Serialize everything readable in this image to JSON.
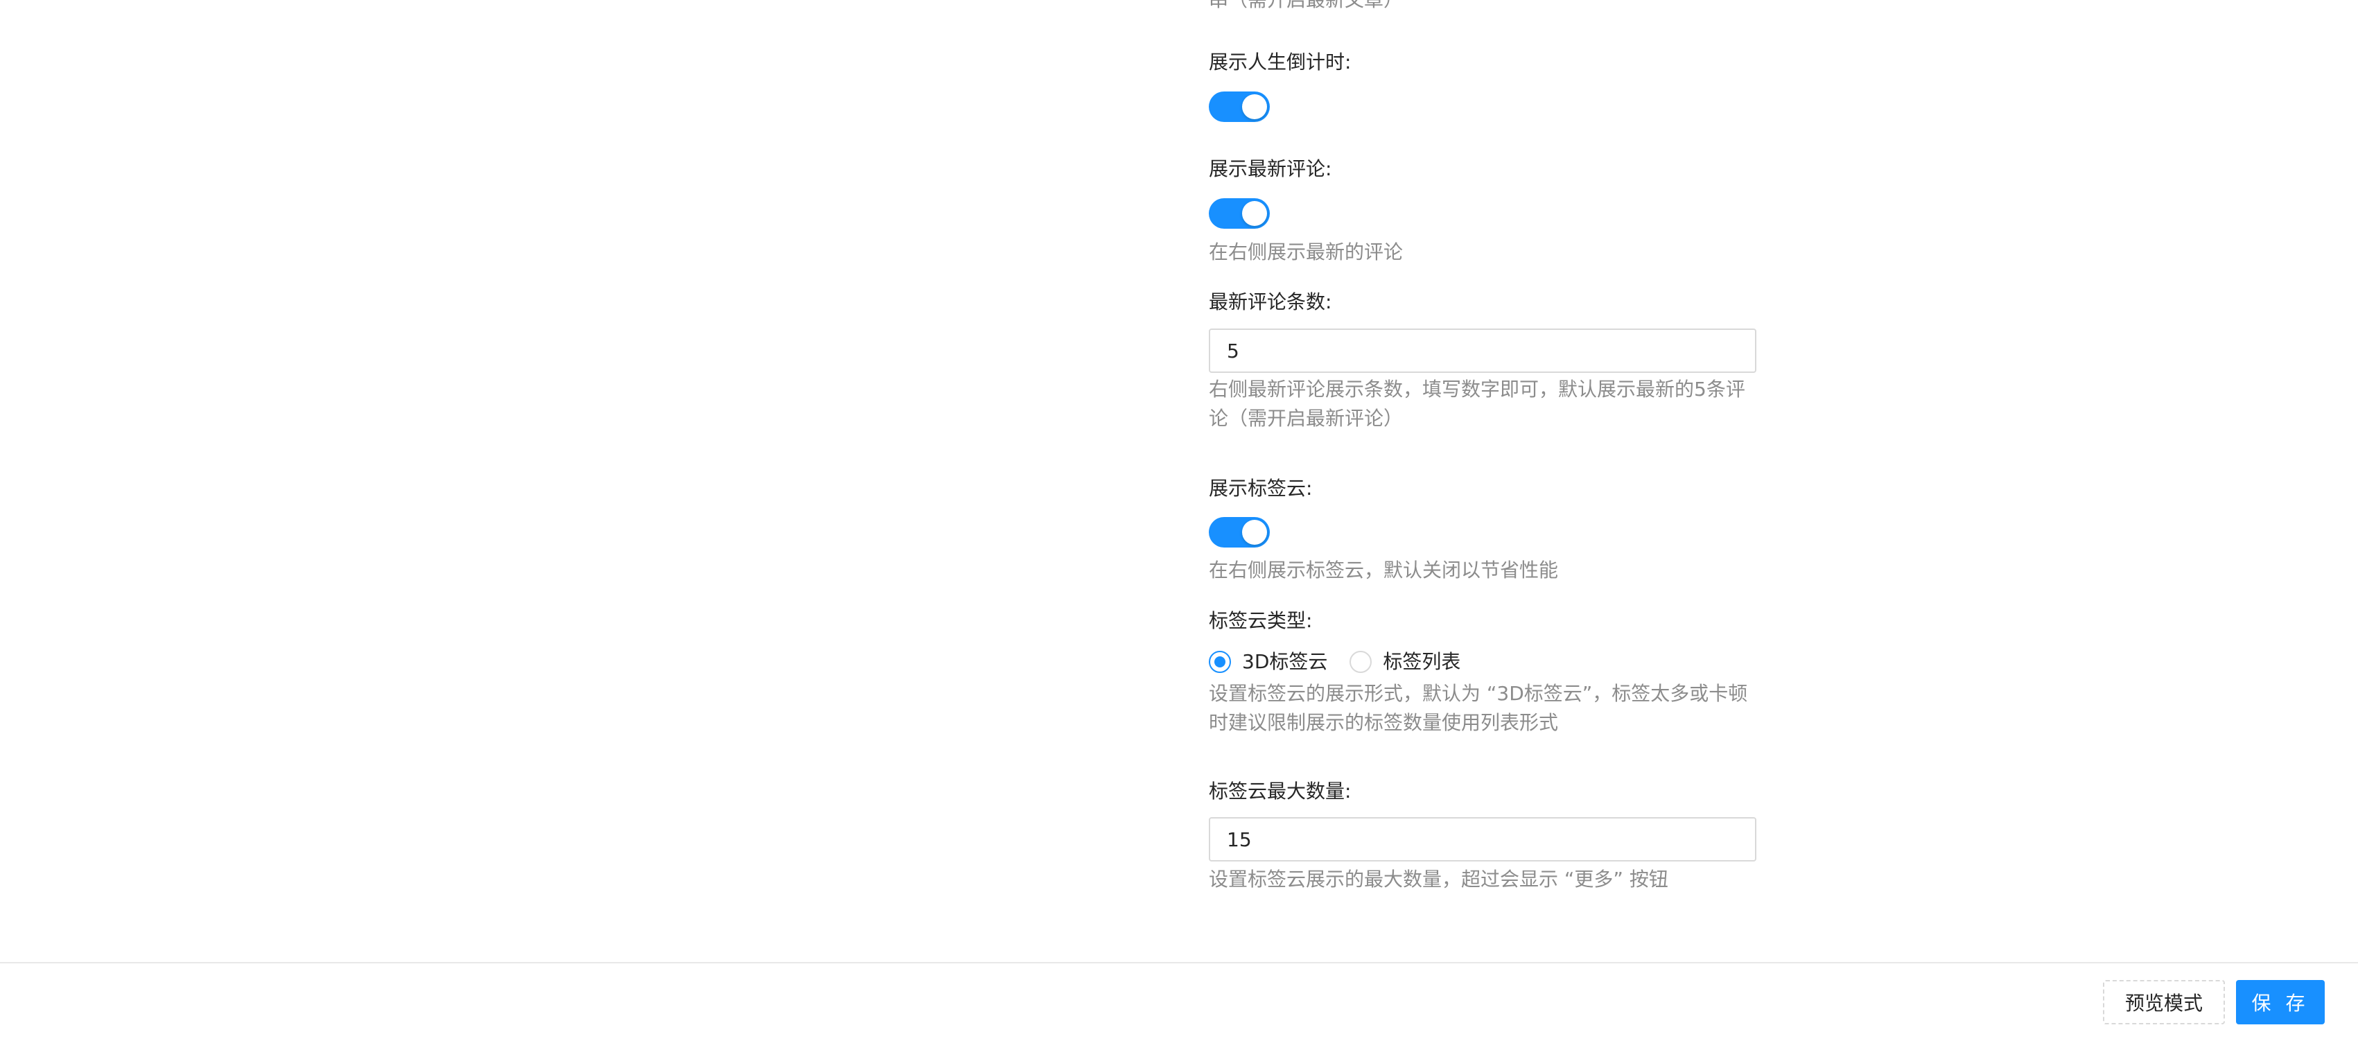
{
  "cut_off_help": "串（需开启最新文章）",
  "life_countdown": {
    "label": "展示人生倒计时:",
    "enabled": true
  },
  "latest_comments": {
    "label": "展示最新评论:",
    "enabled": true,
    "help": "在右侧展示最新的评论"
  },
  "latest_comments_count": {
    "label": "最新评论条数:",
    "value": "5",
    "help": "右侧最新评论展示条数，填写数字即可，默认展示最新的5条评论（需开启最新评论）"
  },
  "tag_cloud": {
    "label": "展示标签云:",
    "enabled": true,
    "help": "在右侧展示标签云，默认关闭以节省性能"
  },
  "tag_cloud_type": {
    "label": "标签云类型:",
    "options": [
      "3D标签云",
      "标签列表"
    ],
    "selected": "3D标签云",
    "help": "设置标签云的展示形式，默认为 “3D标签云”，标签太多或卡顿时建议限制展示的标签数量使用列表形式"
  },
  "tag_cloud_max": {
    "label": "标签云最大数量:",
    "value": "15",
    "help": "设置标签云展示的最大数量，超过会显示 “更多” 按钮"
  },
  "footer": {
    "preview_label": "预览模式",
    "save_label": "保 存"
  },
  "colors": {
    "primary": "#1890ff",
    "help_text": "#8c8c8c",
    "border": "#d9d9d9"
  }
}
